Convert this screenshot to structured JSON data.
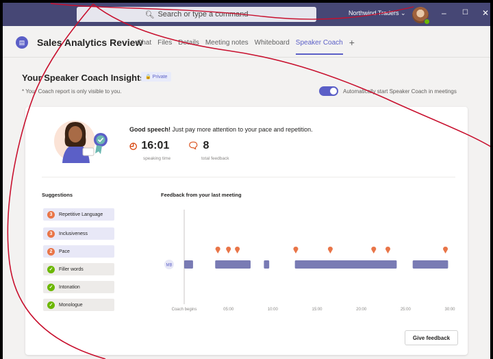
{
  "titlebar": {
    "search_placeholder": "Search or type a command",
    "org_name": "Northwind Traders ⌄"
  },
  "header": {
    "channel_name": "Sales Analytics Review",
    "tabs": [
      {
        "label": "Chat",
        "active": false
      },
      {
        "label": "Files",
        "active": false
      },
      {
        "label": "Details",
        "active": false
      },
      {
        "label": "Meeting notes",
        "active": false
      },
      {
        "label": "Whiteboard",
        "active": false
      },
      {
        "label": "Speaker Coach",
        "active": true
      }
    ],
    "add_tab": "+"
  },
  "insights": {
    "title": "Your Speaker Coach Insights",
    "private_badge": "🔒 Private",
    "privacy_note": "* Your Coach report is only visible to you.",
    "toggle_label": "Automatically start Speaker Coach in meetings",
    "toggle_on": true
  },
  "summary": {
    "headline_bold": "Good speech!",
    "headline_rest": " Just pay more attention to your pace and repetition.",
    "speaking_time": "16:01",
    "speaking_time_label": "speaking time",
    "total_feedback": "8",
    "total_feedback_label": "total feedback"
  },
  "suggestions": {
    "title": "Suggestions",
    "items": [
      {
        "badge": "3",
        "label": "Repetitive Language",
        "status": "issue"
      },
      {
        "badge": "3",
        "label": "Inclusiveness",
        "status": "issue"
      },
      {
        "badge": "2",
        "label": "Pace",
        "status": "issue"
      },
      {
        "badge": "✓",
        "label": "Filler words",
        "status": "ok"
      },
      {
        "badge": "✓",
        "label": "Intonation",
        "status": "ok"
      },
      {
        "badge": "✓",
        "label": "Monologue",
        "status": "ok"
      }
    ]
  },
  "timeline": {
    "title": "Feedback from your last meeting",
    "speaker_initials": "MB",
    "x_ticks": [
      "Coach begins",
      "05:00",
      "10:00",
      "15:00",
      "20:00",
      "25:00",
      "30:00"
    ],
    "segments": [
      [
        0,
        1.0
      ],
      [
        3.5,
        7.5
      ],
      [
        9.0,
        9.6
      ],
      [
        12.5,
        24.0
      ],
      [
        25.8,
        29.8
      ]
    ],
    "markers": [
      3.8,
      5.0,
      6.0,
      12.6,
      16.5,
      21.4,
      23.0,
      29.5
    ],
    "x_max_minutes": 30,
    "accent": "#6264a7",
    "marker_color": "#e97548"
  },
  "actions": {
    "give_feedback": "Give feedback"
  },
  "colors": {
    "titlebar": "#464775",
    "brand": "#5b5fc7",
    "issue": "#e97548",
    "ok": "#6bb700"
  }
}
